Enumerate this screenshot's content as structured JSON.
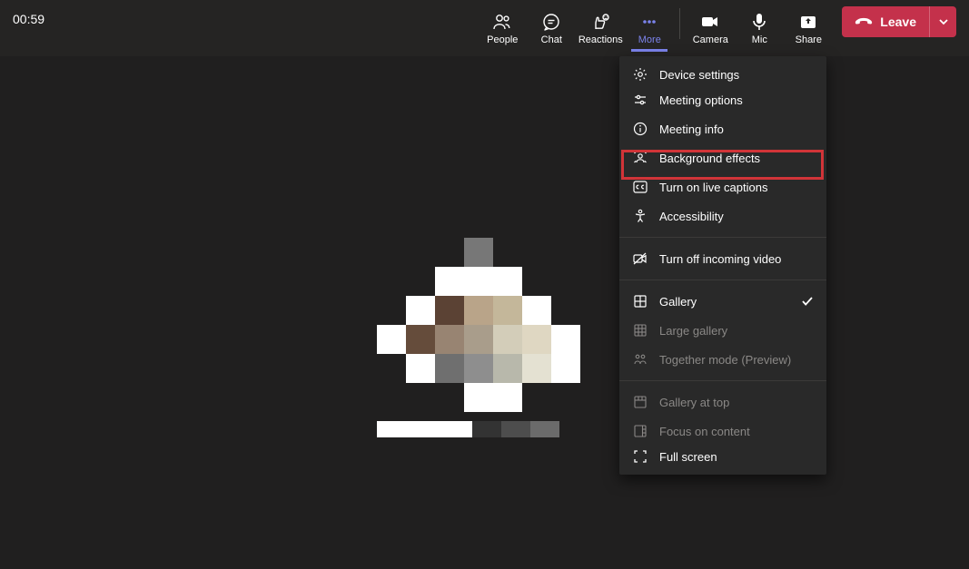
{
  "timer": "00:59",
  "toolbar": {
    "people": "People",
    "chat": "Chat",
    "reactions": "Reactions",
    "more": "More",
    "camera": "Camera",
    "mic": "Mic",
    "share": "Share"
  },
  "leave": {
    "label": "Leave"
  },
  "menu": {
    "device_settings": "Device settings",
    "meeting_options": "Meeting options",
    "meeting_info": "Meeting info",
    "background_effects": "Background effects",
    "live_captions": "Turn on live captions",
    "accessibility": "Accessibility",
    "turn_off_incoming": "Turn off incoming video",
    "gallery": "Gallery",
    "large_gallery": "Large gallery",
    "together_mode": "Together mode (Preview)",
    "gallery_at_top": "Gallery at top",
    "focus_on_content": "Focus on content",
    "full_screen": "Full screen"
  }
}
